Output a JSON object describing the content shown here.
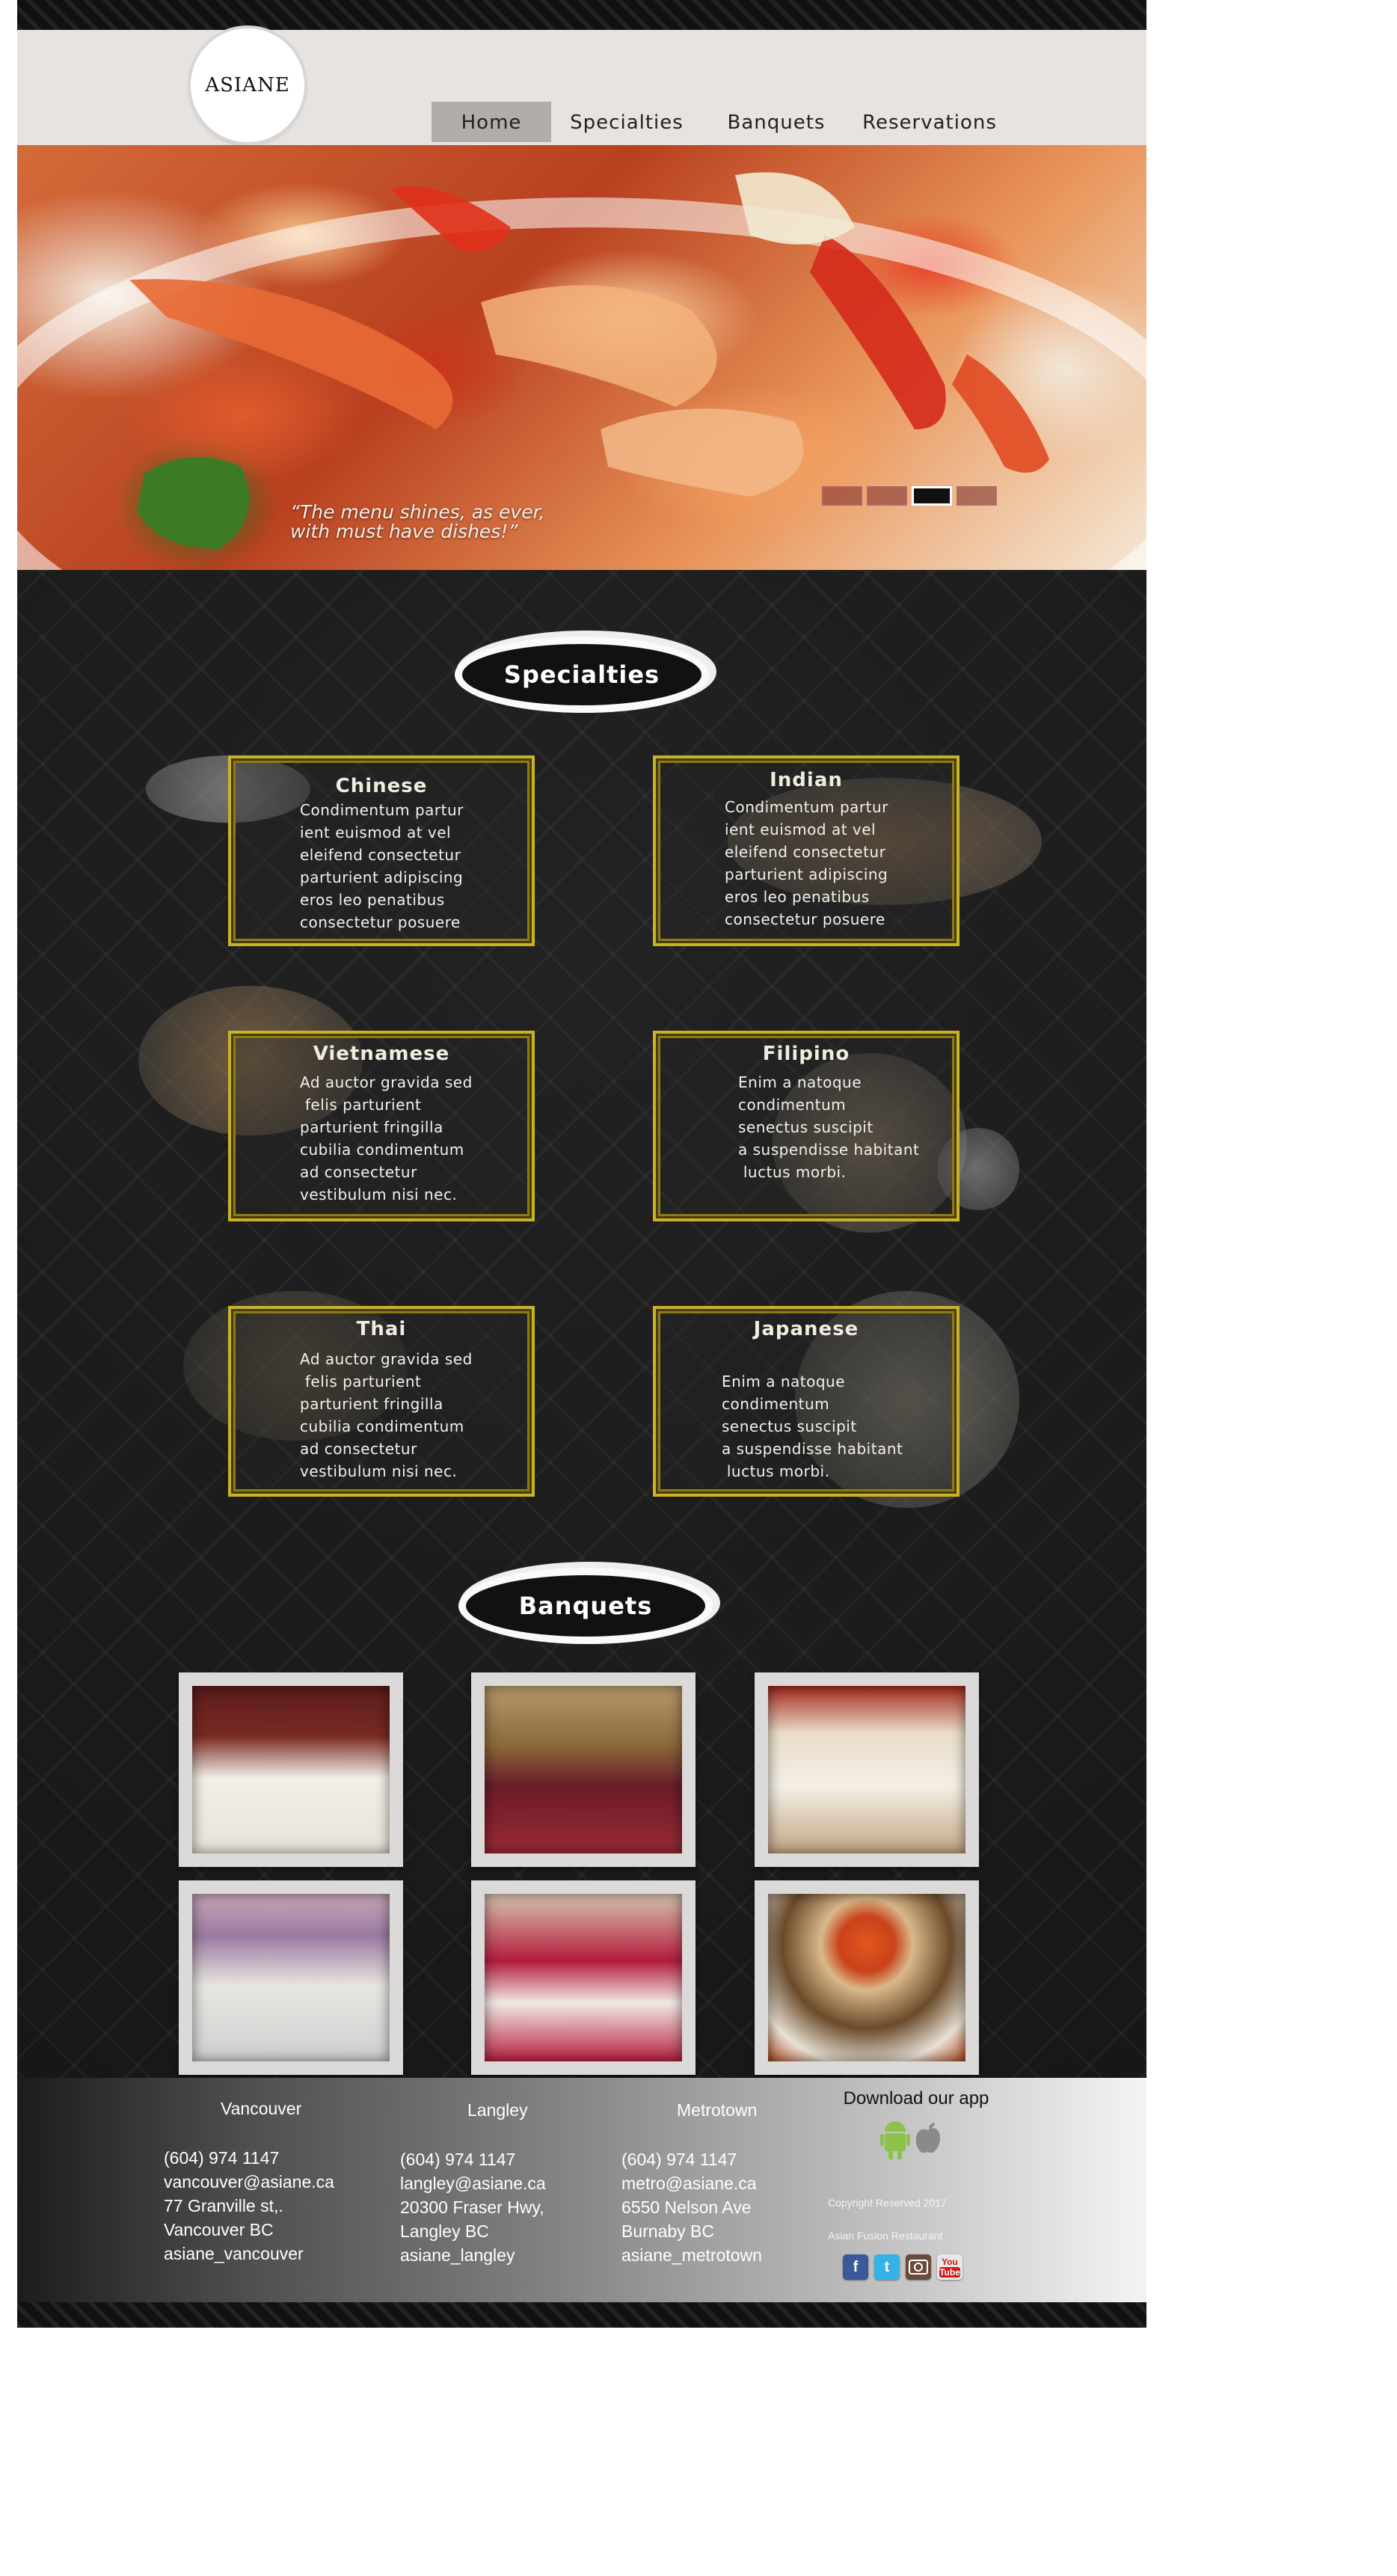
{
  "brand": {
    "logo_text": "ASIANE"
  },
  "nav": [
    {
      "label": "Home",
      "active": true
    },
    {
      "label": "Specialties",
      "active": false
    },
    {
      "label": "Banquets",
      "active": false
    },
    {
      "label": "Reservations",
      "active": false
    }
  ],
  "hero": {
    "quote_line1": "“The menu shines, as ever,",
    "quote_line2": "with must have dishes!”",
    "slide_count": 4,
    "active_slide": 3
  },
  "specialties": {
    "heading": "Specialties",
    "cards": [
      {
        "title": "Chinese",
        "lines": [
          "Condimentum partur",
          "ient euismod at vel",
          "eleifend consectetur",
          "parturient adipiscing",
          "eros leo penatibus",
          "consectetur posuere"
        ]
      },
      {
        "title": "Indian",
        "lines": [
          "Condimentum partur",
          "ient euismod at vel",
          "eleifend consectetur",
          "parturient adipiscing",
          "eros leo penatibus",
          "consectetur posuere"
        ]
      },
      {
        "title": "Vietnamese",
        "lines": [
          "Ad auctor gravida sed",
          " felis parturient",
          "parturient fringilla",
          "cubilia condimentum",
          "ad consectetur",
          "vestibulum nisi nec."
        ]
      },
      {
        "title": "Filipino",
        "lines": [
          "Enim a natoque",
          "condimentum",
          "senectus suscipit",
          "a suspendisse habitant",
          " luctus morbi."
        ]
      },
      {
        "title": "Thai",
        "lines": [
          "Ad auctor gravida sed",
          " felis parturient",
          "parturient fringilla",
          "cubilia condimentum",
          "ad consectetur",
          "vestibulum nisi nec."
        ]
      },
      {
        "title": "Japanese",
        "lines": [
          "Enim a natoque",
          "condimentum",
          "senectus suscipit",
          "a suspendisse habitant",
          " luctus morbi."
        ]
      }
    ]
  },
  "banquets": {
    "heading": "Banquets",
    "photos": [
      "banquet-hall-photo",
      "ballroom-photo",
      "dining-room-photo",
      "reception-hall-photo",
      "red-table-hall-photo",
      "stage-hall-photo"
    ]
  },
  "footer": {
    "locations": [
      {
        "city": "Vancouver",
        "phone": "(604) 974 1147",
        "email": "vancouver@asiane.ca",
        "address1": "77 Granville st,.",
        "address2": "Vancouver BC",
        "social": "asiane_vancouver"
      },
      {
        "city": "Langley",
        "phone": "(604) 974 1147",
        "email": "langley@asiane.ca",
        "address1": "20300 Fraser Hwy,",
        "address2": "Langley BC",
        "social": "asiane_langley"
      },
      {
        "city": "Metrotown",
        "phone": "(604) 974 1147",
        "email": "metro@asiane.ca",
        "address1": "6550 Nelson Ave",
        "address2": "Burnaby BC",
        "social": "asiane_metrotown"
      }
    ],
    "download_app": "Download our app",
    "app_icons": [
      "android-icon",
      "apple-icon"
    ],
    "copyright": "Copyright Reserved 2017",
    "tagline": "Asian Fusion Restaurant",
    "social_icons": [
      "facebook-icon",
      "twitter-icon",
      "instagram-icon",
      "youtube-icon"
    ],
    "social_glyphs": {
      "facebook": "f",
      "twitter": "t",
      "youtube_top": "You",
      "youtube_bottom": "Tube"
    }
  }
}
